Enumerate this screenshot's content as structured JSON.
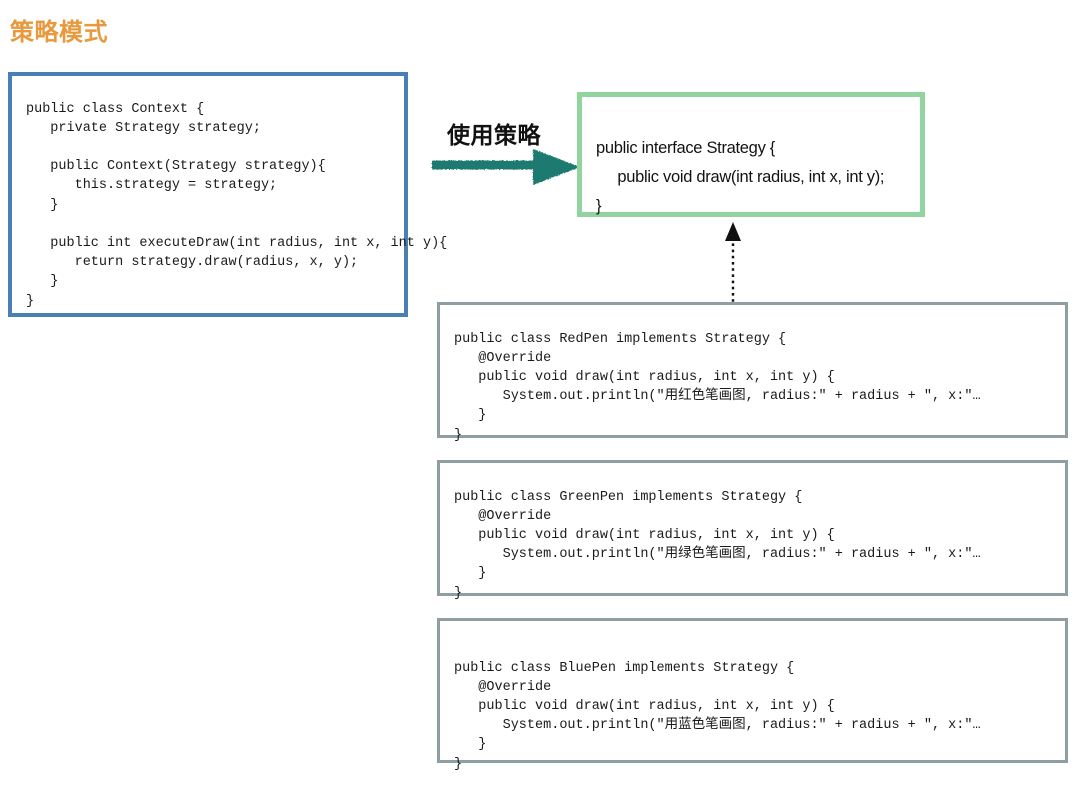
{
  "page": {
    "title": "策略模式",
    "title_color": "#e8993d",
    "background": "#ffffff"
  },
  "context_box": {
    "name": "Context class",
    "border_color": "#4a7fb5",
    "code": "public class Context {\n   private Strategy strategy;\n\n   public Context(Strategy strategy){\n      this.strategy = strategy;\n   }\n\n   public int executeDraw(int radius, int x, int y){\n      return strategy.draw(radius, x, y);\n   }\n}"
  },
  "use_strategy": {
    "label": "使用策略",
    "arrow_color": "#1d7a70",
    "arrow_direction": "right"
  },
  "interface_box": {
    "name": "Strategy interface",
    "border_color": "#92d4a0",
    "code": "public interface Strategy {\n     public void draw(int radius, int x, int y);\n}"
  },
  "implements_arrow": {
    "style": "dotted",
    "head": "hollow-triangle-solid",
    "direction": "up",
    "color": "#111111"
  },
  "implementations": [
    {
      "name": "RedPen class",
      "border_color": "#8e9ea2",
      "code": "public class RedPen implements Strategy {\n   @Override\n   public void draw(int radius, int x, int y) {\n      System.out.println(\"用红色笔画图, radius:\" + radius + \", x:\"…\n   }\n}"
    },
    {
      "name": "GreenPen class",
      "border_color": "#8e9ea2",
      "code": "public class GreenPen implements Strategy {\n   @Override\n   public void draw(int radius, int x, int y) {\n      System.out.println(\"用绿色笔画图, radius:\" + radius + \", x:\"…\n   }\n}"
    },
    {
      "name": "BluePen class",
      "border_color": "#8e9ea2",
      "code": "public class BluePen implements Strategy {\n   @Override\n   public void draw(int radius, int x, int y) {\n      System.out.println(\"用蓝色笔画图, radius:\" + radius + \", x:\"…\n   }\n}"
    }
  ]
}
